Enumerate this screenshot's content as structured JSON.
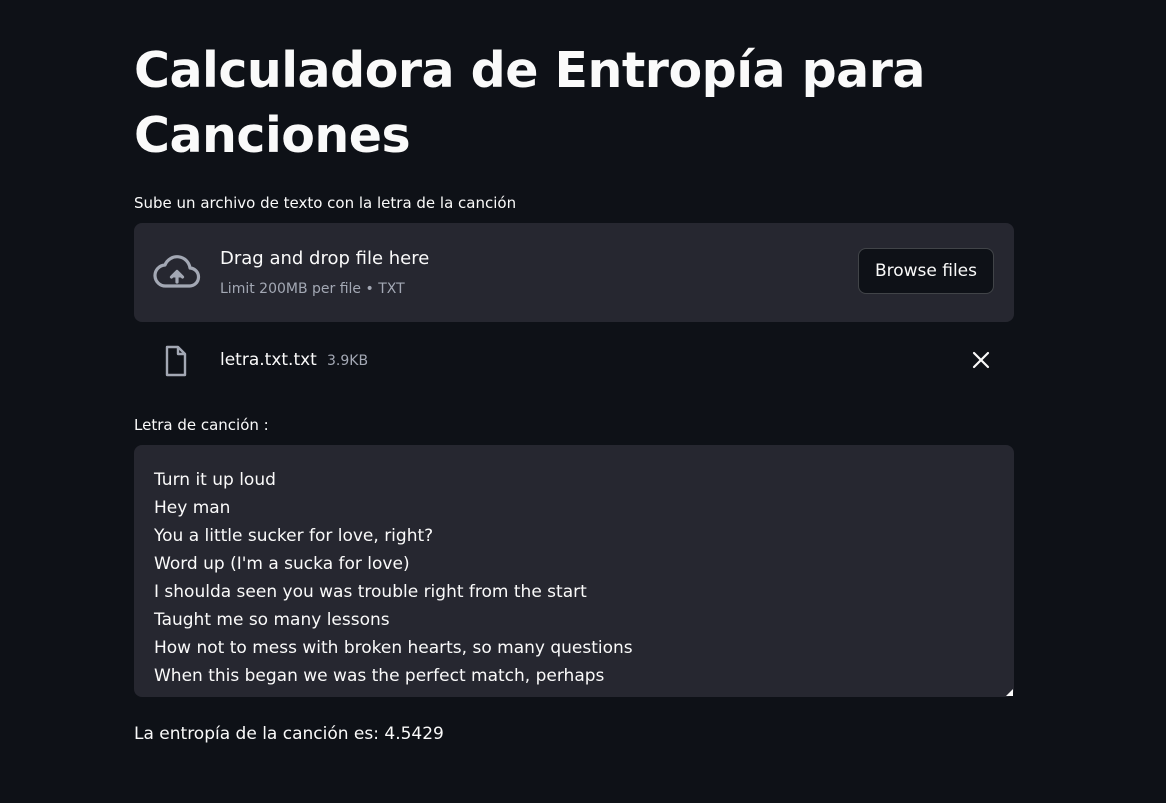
{
  "page": {
    "title": "Calculadora de Entropía para Canciones"
  },
  "uploader": {
    "label": "Sube un archivo de texto con la letra de la canción",
    "drop_title": "Drag and drop file here",
    "drop_subtitle": "Limit 200MB per file • TXT",
    "browse_label": "Browse files",
    "icon": "cloud-upload-icon"
  },
  "uploaded_file": {
    "name": "letra.txt.txt",
    "size": "3.9KB",
    "icon": "file-icon"
  },
  "lyrics": {
    "label": "Letra de canción :",
    "value": "Turn it up loud\nHey man\nYou a little sucker for love, right?\nWord up (I'm a sucka for love)\nI shoulda seen you was trouble right from the start\nTaught me so many lessons\nHow not to mess with broken hearts, so many questions\nWhen this began we was the perfect match, perhaps"
  },
  "result": {
    "text": "La entropía de la canción es: 4.5429"
  },
  "colors": {
    "background": "#0e1117",
    "surface": "#262730",
    "text": "#fafafa",
    "muted": "#a3a8b4"
  }
}
